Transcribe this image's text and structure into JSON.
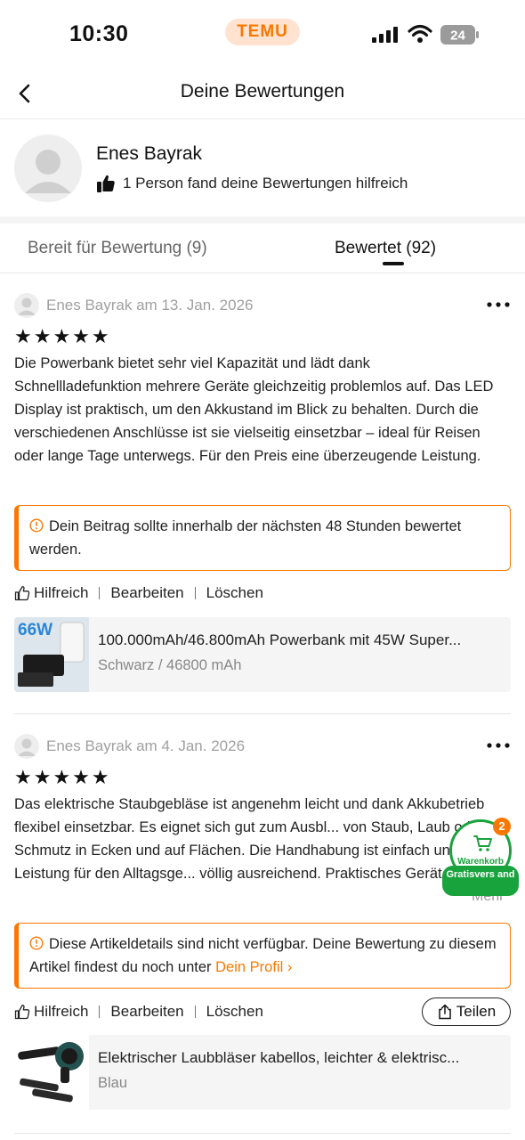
{
  "status_bar": {
    "time": "10:30",
    "brand": "TEMU",
    "battery": "24"
  },
  "header": {
    "title": "Deine Bewertungen"
  },
  "profile": {
    "name": "Enes Bayrak",
    "helpful_text": "1 Person fand deine Bewertungen hilfreich"
  },
  "tabs": [
    {
      "label": "Bereit für Bewertung (9)"
    },
    {
      "label": "Bewertet (92)"
    }
  ],
  "reviews": [
    {
      "meta": "Enes Bayrak am 13. Jan. 2026",
      "stars": "★★★★★",
      "rating": 5,
      "text": "Die Powerbank bietet sehr viel Kapazität und lädt dank Schnellladefunktion mehrere Geräte gleichzeitig problemlos auf. Das LED Display ist praktisch, um den Akkustand im Blick zu behalten. Durch die verschiedenen Anschlüsse ist sie vielseitig einsetzbar – ideal für Reisen oder lange Tage unterwegs. Für den Preis eine überzeugende Leistung.",
      "notice": "Dein Beitrag sollte innerhalb der nächsten 48 Stunden bewertet werden.",
      "actions": {
        "helpful": "Hilfreich",
        "edit": "Bearbeiten",
        "delete": "Löschen"
      },
      "product": {
        "image_label": "66W",
        "title": "100.000mAh/46.800mAh Powerbank mit 45W Super...",
        "variant": "Schwarz / 46800 mAh"
      }
    },
    {
      "meta": "Enes Bayrak am 4. Jan. 2026",
      "stars": "★★★★★",
      "rating": 5,
      "text": "Das elektrische Staubgebläse ist angenehm leicht und dank Akkubetrieb flexibel einsetzbar. Es eignet sich gut zum Ausbl... von Staub, Laub oder Schmutz in Ecken und auf Flächen. Die Handhabung ist einfach und die Leistung für den Alltagsge... völlig ausreichend. Praktisches Gerät für schnelle",
      "more": "Mehr",
      "notice": "Diese Artikeldetails sind nicht verfügbar. Deine Bewertung zu diesem Artikel findest du noch unter",
      "notice_link": "Dein Profil",
      "actions": {
        "helpful": "Hilfreich",
        "edit": "Bearbeiten",
        "delete": "Löschen",
        "share": "Teilen"
      },
      "product": {
        "title": "Elektrischer Laubbläser kabellos, leichter & elektrisc...",
        "variant": "Blau"
      }
    }
  ],
  "cart": {
    "label": "Warenkorb",
    "count": "2",
    "shipping": "Gratisvers and"
  },
  "colors": {
    "accent": "#fb7701",
    "cart_green": "#19a33d"
  }
}
